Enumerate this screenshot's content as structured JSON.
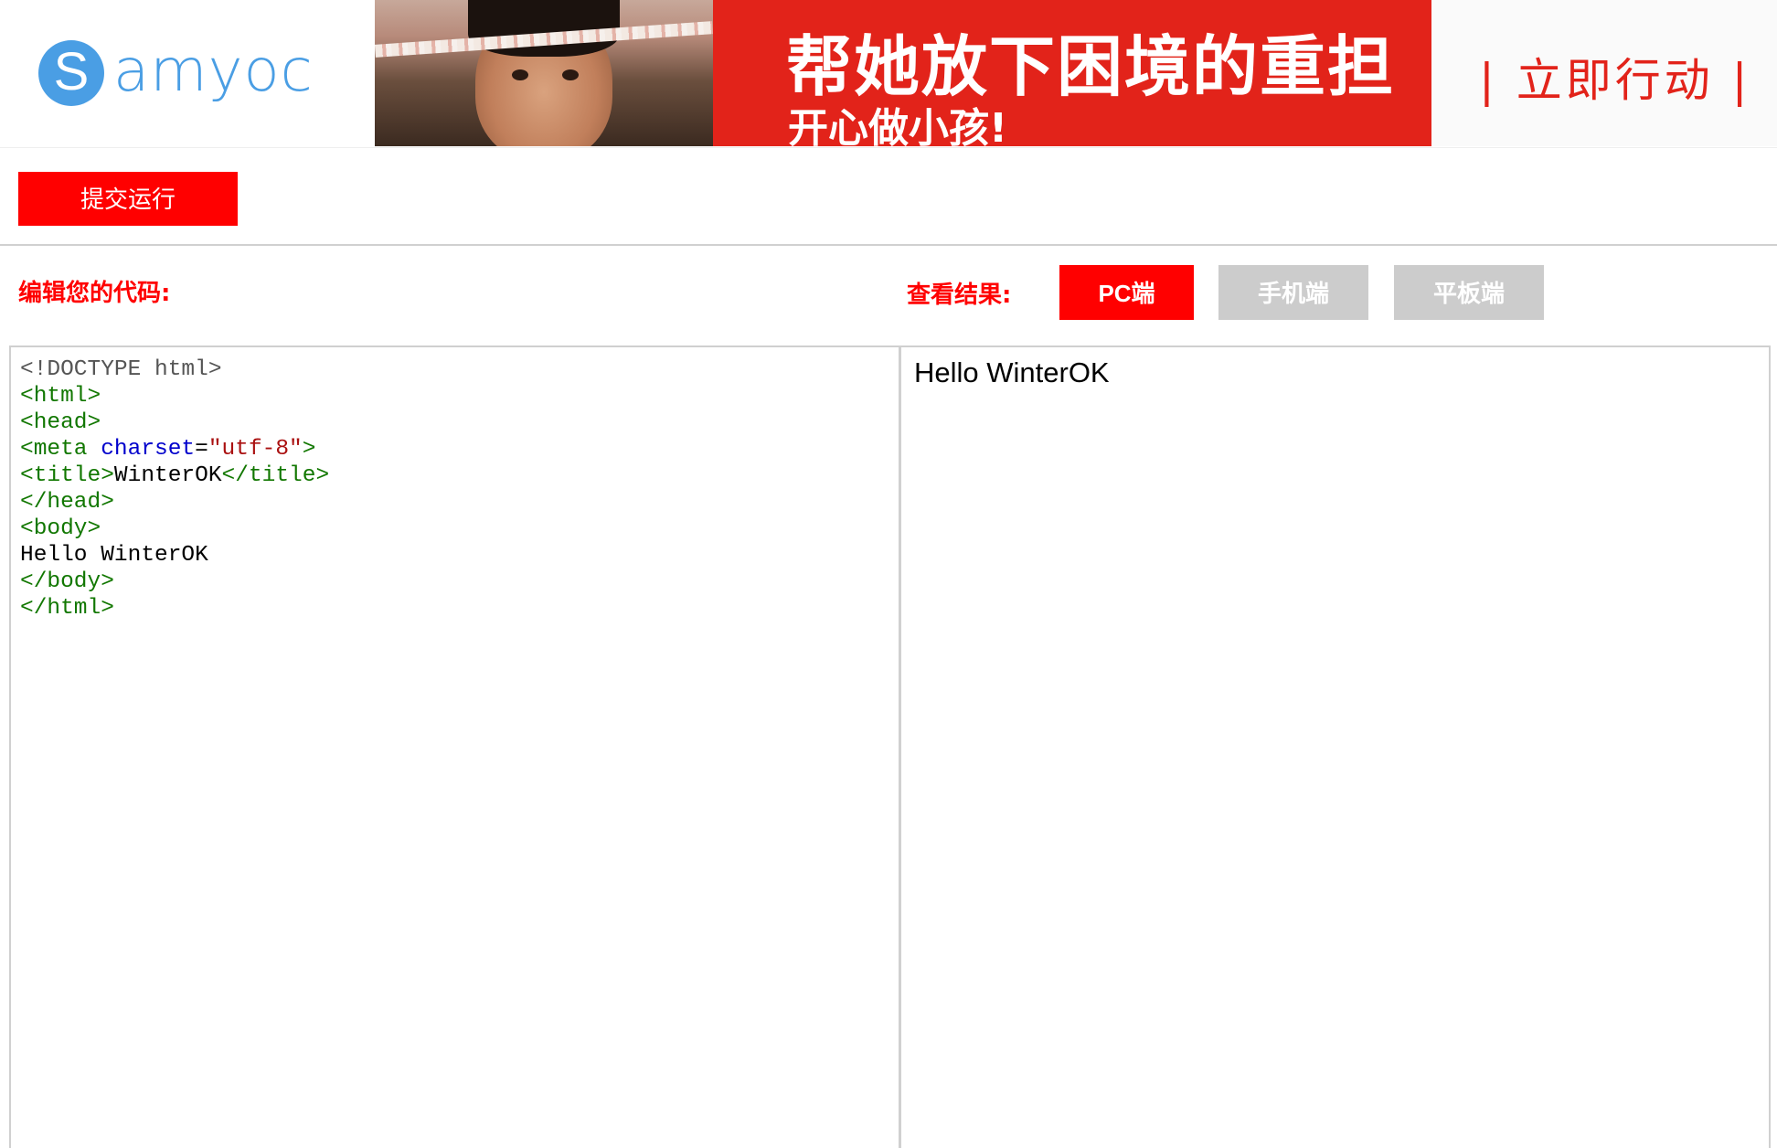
{
  "header": {
    "logo": {
      "letter": "S",
      "text": "amyoc",
      "color": "#4a9ee4"
    },
    "banner": {
      "title": "帮她放下困境的重担",
      "subtitle": "开心做小孩!",
      "cta": "| 立即行动 |",
      "color": "#e2231a"
    }
  },
  "toolbar": {
    "submit_label": "提交运行"
  },
  "labels": {
    "edit": "编辑您的代码:",
    "result": "查看结果:"
  },
  "view_buttons": [
    {
      "label": "PC端",
      "active": true
    },
    {
      "label": "手机端",
      "active": false
    },
    {
      "label": "平板端",
      "active": false
    }
  ],
  "editor": {
    "lines": [
      [
        {
          "t": "<!DOCTYPE html>",
          "c": "gray"
        }
      ],
      [
        {
          "t": "<html>",
          "c": "green"
        }
      ],
      [
        {
          "t": "<head>",
          "c": "green"
        }
      ],
      [
        {
          "t": "<meta ",
          "c": "green"
        },
        {
          "t": "charset",
          "c": "blue"
        },
        {
          "t": "=",
          "c": "black"
        },
        {
          "t": "\"utf-8\"",
          "c": "red"
        },
        {
          "t": ">",
          "c": "green"
        }
      ],
      [
        {
          "t": "<title>",
          "c": "green"
        },
        {
          "t": "WinterOK",
          "c": "black"
        },
        {
          "t": "</title>",
          "c": "green"
        }
      ],
      [
        {
          "t": "</head>",
          "c": "green"
        }
      ],
      [
        {
          "t": "<body>",
          "c": "green"
        }
      ],
      [
        {
          "t": "Hello WinterOK",
          "c": "black"
        }
      ],
      [
        {
          "t": "</body>",
          "c": "green"
        }
      ],
      [
        {
          "t": "</html>",
          "c": "green"
        }
      ]
    ]
  },
  "result": {
    "text": "Hello WinterOK"
  },
  "colors": {
    "accent": "#ff0000",
    "inactive_button": "#cccccc",
    "border": "#d0d0d0"
  }
}
